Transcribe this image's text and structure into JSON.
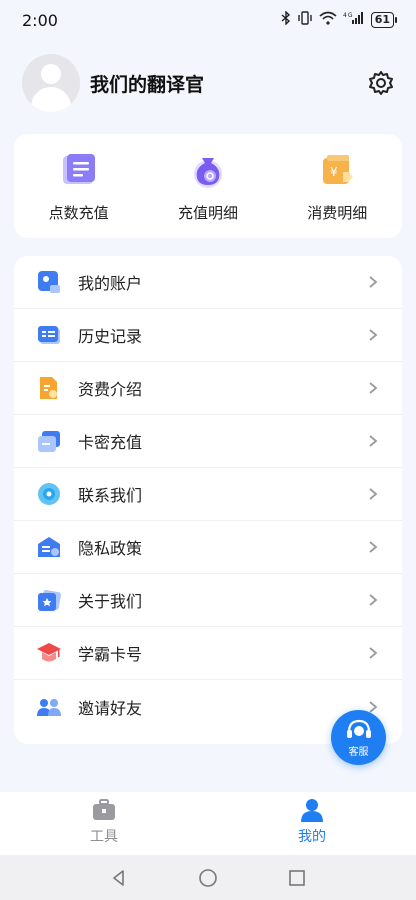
{
  "status_bar": {
    "time": "2:00",
    "icons": [
      "bluetooth-icon",
      "vibrate-icon",
      "wifi-icon",
      "signal-icon"
    ],
    "signal_label": "4G",
    "battery": "61"
  },
  "profile": {
    "name": "我们的翻译官"
  },
  "quick_actions": [
    {
      "label": "点数充值",
      "icon": "recharge-points-icon"
    },
    {
      "label": "充值明细",
      "icon": "money-bag-icon"
    },
    {
      "label": "消费明细",
      "icon": "wallet-icon"
    }
  ],
  "menu": [
    {
      "label": "我的账户",
      "icon": "account-icon"
    },
    {
      "label": "历史记录",
      "icon": "history-icon"
    },
    {
      "label": "资费介绍",
      "icon": "pricing-doc-icon"
    },
    {
      "label": "卡密充值",
      "icon": "card-recharge-icon"
    },
    {
      "label": "联系我们",
      "icon": "contact-icon"
    },
    {
      "label": "隐私政策",
      "icon": "privacy-icon"
    },
    {
      "label": "关于我们",
      "icon": "about-icon"
    },
    {
      "label": "学霸卡号",
      "icon": "graduation-cap-icon"
    },
    {
      "label": "邀请好友",
      "icon": "invite-friends-icon"
    }
  ],
  "customer_service": {
    "label": "客服"
  },
  "tabbar": {
    "tools": "工具",
    "mine": "我的"
  },
  "colors": {
    "accent": "#1e7ef2",
    "background": "#f3f6fc"
  }
}
